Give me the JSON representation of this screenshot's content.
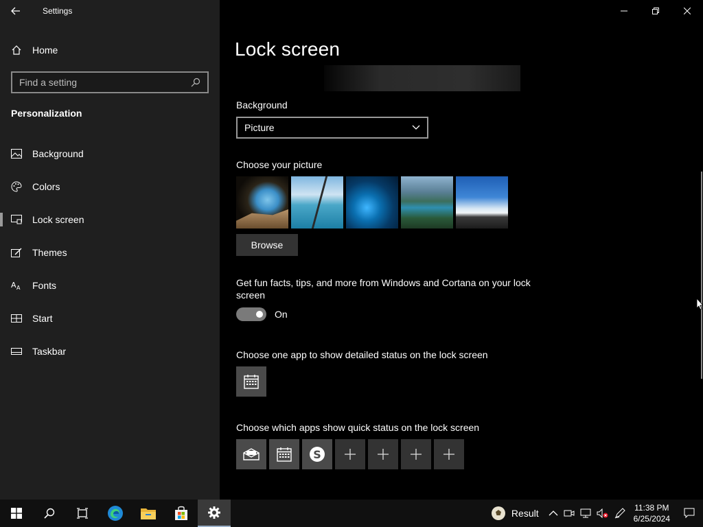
{
  "window": {
    "app_title": "Settings"
  },
  "sidebar": {
    "home_label": "Home",
    "search_placeholder": "Find a setting",
    "section_title": "Personalization",
    "items": [
      {
        "label": "Background",
        "icon": "picture-icon"
      },
      {
        "label": "Colors",
        "icon": "palette-icon"
      },
      {
        "label": "Lock screen",
        "icon": "lock-screen-icon",
        "active": true
      },
      {
        "label": "Themes",
        "icon": "themes-icon"
      },
      {
        "label": "Fonts",
        "icon": "fonts-icon"
      },
      {
        "label": "Start",
        "icon": "start-icon"
      },
      {
        "label": "Taskbar",
        "icon": "taskbar-icon"
      }
    ]
  },
  "main": {
    "title": "Lock screen",
    "background_label": "Background",
    "background_value": "Picture",
    "choose_picture_label": "Choose your picture",
    "browse_label": "Browse",
    "fun_facts_label": "Get fun facts, tips, and more from Windows and Cortana on your lock screen",
    "toggle_state": "On",
    "detailed_status_label": "Choose one app to show detailed status on the lock screen",
    "quick_status_label": "Choose which apps show quick status on the lock screen",
    "quick_apps": [
      "mail-icon",
      "calendar-icon",
      "skype-icon",
      "plus-icon",
      "plus-icon",
      "plus-icon",
      "plus-icon"
    ]
  },
  "taskbar": {
    "apps": [
      "windows-start-icon",
      "search-icon",
      "task-view-icon",
      "edge-icon",
      "file-explorer-icon",
      "store-icon",
      "settings-icon"
    ],
    "tray_label": "Result",
    "time": "11:38 PM",
    "date": "6/25/2024"
  },
  "colors": {
    "sidebar_bg": "#1f1f1f",
    "content_bg": "#000000",
    "taskbar_bg": "#101010"
  }
}
